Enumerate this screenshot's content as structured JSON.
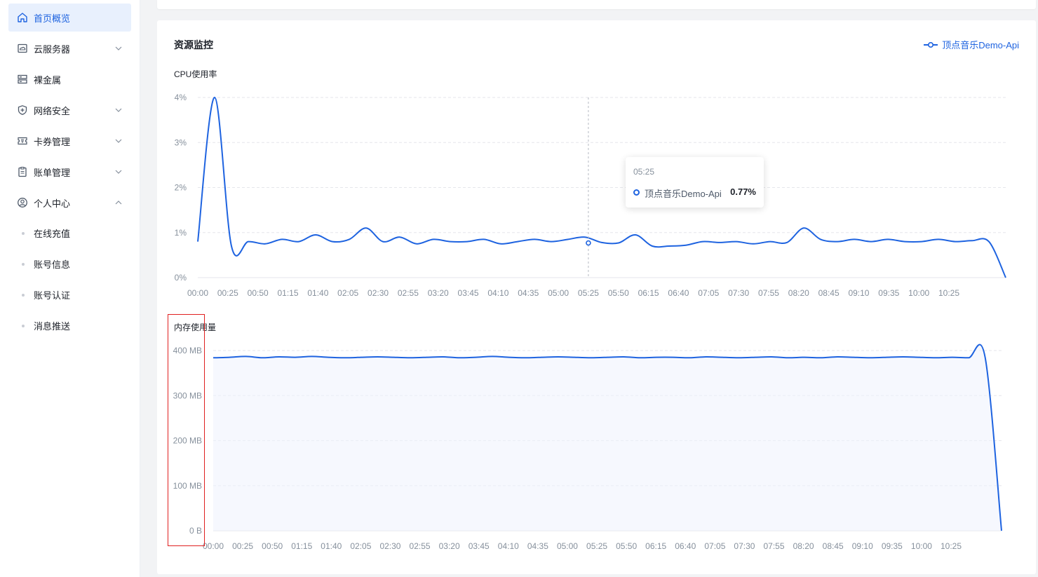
{
  "sidebar": {
    "items": [
      {
        "label": "首页概览",
        "icon": "home-icon",
        "active": true
      },
      {
        "label": "云服务器",
        "icon": "cloud-server-icon",
        "chevron": "down"
      },
      {
        "label": "裸金属",
        "icon": "server-rack-icon"
      },
      {
        "label": "网络安全",
        "icon": "shield-icon",
        "chevron": "down"
      },
      {
        "label": "卡券管理",
        "icon": "ticket-icon",
        "chevron": "down"
      },
      {
        "label": "账单管理",
        "icon": "clipboard-icon",
        "chevron": "down"
      },
      {
        "label": "个人中心",
        "icon": "user-circle-icon",
        "chevron": "up"
      }
    ],
    "sub_items": [
      "在线充值",
      "账号信息",
      "账号认证",
      "消息推送"
    ]
  },
  "card": {
    "title": "资源监控",
    "legend_label": "顶点音乐Demo-Api"
  },
  "tooltip": {
    "time": "05:25",
    "series": "顶点音乐Demo-Api",
    "value": "0.77%"
  },
  "colors": {
    "accent": "#1e63e0",
    "grid": "#e5e6eb",
    "tick": "#86909c"
  },
  "chart_data": [
    {
      "type": "line",
      "title": "CPU使用率",
      "series_name": "顶点音乐Demo-Api",
      "x": [
        "00:00",
        "00:25",
        "00:50",
        "01:15",
        "01:40",
        "02:05",
        "02:30",
        "02:55",
        "03:20",
        "03:45",
        "04:10",
        "04:35",
        "05:00",
        "05:25",
        "05:50",
        "06:15",
        "06:40",
        "07:05",
        "07:30",
        "07:55",
        "08:20",
        "08:45",
        "09:10",
        "09:35",
        "10:00",
        "10:25"
      ],
      "y_ticks": [
        "0%",
        "1%",
        "2%",
        "3%",
        "4%"
      ],
      "ylim": [
        0,
        4
      ],
      "values": [
        0.8,
        4.0,
        0.7,
        0.8,
        0.75,
        0.85,
        0.8,
        0.95,
        0.8,
        0.85,
        1.1,
        0.8,
        0.9,
        0.75,
        0.85,
        0.8,
        0.8,
        0.85,
        0.75,
        0.8,
        0.85,
        0.8,
        0.85,
        0.9,
        0.78,
        0.77,
        0.95,
        0.7,
        0.7,
        0.72,
        0.8,
        0.78,
        0.8,
        0.75,
        0.8,
        0.78,
        1.1,
        0.85,
        0.8,
        0.85,
        0.8,
        0.85,
        0.8,
        0.8,
        0.85,
        0.8,
        0.82,
        0.8,
        0.0
      ],
      "grid": true
    },
    {
      "type": "area",
      "title": "内存使用量",
      "series_name": "顶点音乐Demo-Api",
      "x": [
        "00:00",
        "00:25",
        "00:50",
        "01:15",
        "01:40",
        "02:05",
        "02:30",
        "02:55",
        "03:20",
        "03:45",
        "04:10",
        "04:35",
        "05:00",
        "05:25",
        "05:50",
        "06:15",
        "06:40",
        "07:05",
        "07:30",
        "07:55",
        "08:20",
        "08:45",
        "09:10",
        "09:35",
        "10:00",
        "10:25"
      ],
      "y_ticks": [
        "0 B",
        "100 MB",
        "200 MB",
        "300 MB",
        "400 MB"
      ],
      "ylim": [
        0,
        400
      ],
      "values": [
        384,
        385,
        387,
        384,
        386,
        385,
        387,
        385,
        384,
        385,
        386,
        385,
        384,
        385,
        386,
        384,
        385,
        387,
        385,
        384,
        385,
        386,
        385,
        384,
        385,
        386,
        384,
        385,
        385,
        384,
        386,
        385,
        384,
        385,
        386,
        384,
        385,
        384,
        386,
        385,
        384,
        385,
        386,
        385,
        384,
        385,
        384,
        385,
        0
      ],
      "grid": true
    }
  ]
}
